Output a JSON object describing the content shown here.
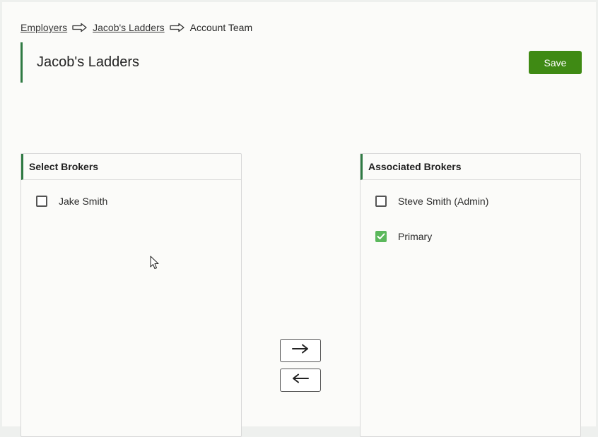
{
  "breadcrumb": {
    "items": [
      {
        "label": "Employers",
        "link": true
      },
      {
        "label": "Jacob's Ladders",
        "link": true
      },
      {
        "label": "Account Team",
        "link": false
      }
    ]
  },
  "header": {
    "title": "Jacob's Ladders",
    "save_label": "Save"
  },
  "select_panel": {
    "title": "Select Brokers",
    "items": [
      {
        "label": "Jake Smith",
        "checked": false
      }
    ]
  },
  "associated_panel": {
    "title": "Associated Brokers",
    "items": [
      {
        "label": "Steve Smith (Admin)",
        "checked": false
      },
      {
        "label": "Primary",
        "checked": true
      }
    ]
  },
  "transfer": {
    "add_icon": "arrow-right-icon",
    "remove_icon": "arrow-left-icon"
  },
  "colors": {
    "accent": "#2f7a43",
    "save_button": "#3f8a14",
    "checkbox_checked": "#5bb85c"
  }
}
